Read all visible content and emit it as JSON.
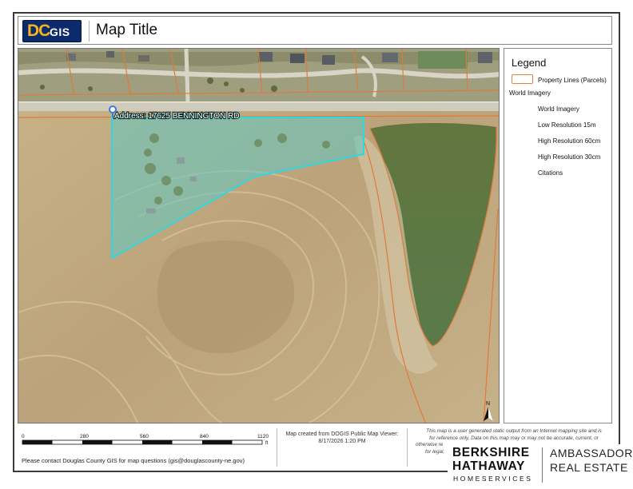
{
  "header": {
    "logo_dc": "DC",
    "logo_gis": "GIS",
    "title": "Map Title"
  },
  "map": {
    "address_label": "Address: 17625 BENNINGTON RD",
    "north_label": "N",
    "colors": {
      "parcel_line": "#e07a3a",
      "selection_fill": "#5ec9c4",
      "selection_stroke": "#2fd7e0",
      "field": "#bfa77a",
      "pond": "#5f7a45",
      "road": "#d6d2c6"
    }
  },
  "legend": {
    "title": "Legend",
    "items": [
      {
        "label": "Property Lines (Parcels)"
      },
      {
        "label": "World Imagery"
      },
      {
        "label": "World Imagery"
      },
      {
        "label": "Low Resolution 15m"
      },
      {
        "label": "High Resolution 60cm"
      },
      {
        "label": "High Resolution 30cm"
      },
      {
        "label": "Citations"
      }
    ]
  },
  "scale": {
    "ticks": [
      "0",
      "280",
      "560",
      "840",
      "1120"
    ],
    "unit": "ft"
  },
  "footer": {
    "contact": "Please contact Douglas County GIS for map questions (gis@douglascounty-ne.gov)",
    "created_line1": "Map created from DOGIS Public Map Viewer:",
    "created_line2": "8/17/2026 1:20 PM",
    "disclaimer_line1": "This map is a user generated static output from an Internet mapping site and is",
    "disclaimer_line2": "for reference only. Data on this map may or may not be accurate, current, or",
    "disclaimer_line3": "otherwise re",
    "disclaimer_line4": "for legal,"
  },
  "brand": {
    "line1": "BERKSHIRE",
    "line2": "HATHAWAY",
    "line3": "HOMESERVICES",
    "right1": "AMBASSADOR",
    "right2": "REAL ESTATE"
  }
}
